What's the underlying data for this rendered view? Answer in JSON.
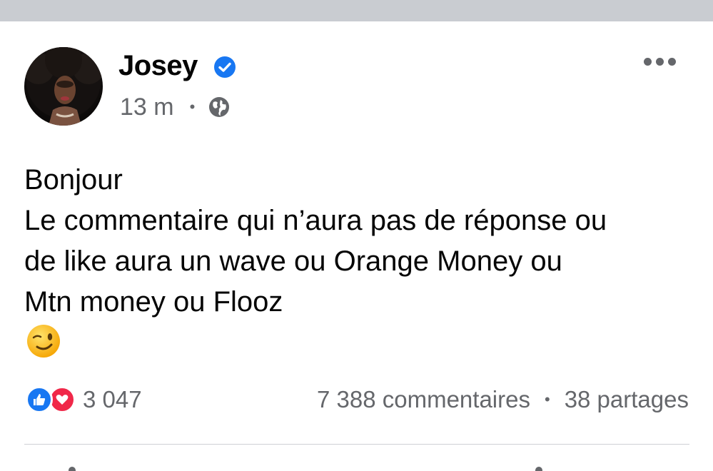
{
  "post": {
    "author": "Josey",
    "verified": true,
    "time": "13 m",
    "separator": "•",
    "privacy_icon": "globe-icon",
    "menu_icon": "more-icon",
    "text_lines": [
      "Bonjour",
      "Le commentaire qui n’aura pas de réponse ou",
      "de like aura un wave ou Orange Money ou",
      "Mtn money ou Flooz"
    ],
    "emoji": "winking-face"
  },
  "reactions": {
    "types": [
      "like",
      "love"
    ],
    "count": "3 047"
  },
  "stats": {
    "comments": "7 388 commentaires",
    "separator": "•",
    "shares": "38 partages"
  },
  "colors": {
    "top_strip": "#c9ccd1",
    "verified_blue": "#1877f2",
    "secondary_text": "#65676b",
    "love_red": "#f02849"
  }
}
